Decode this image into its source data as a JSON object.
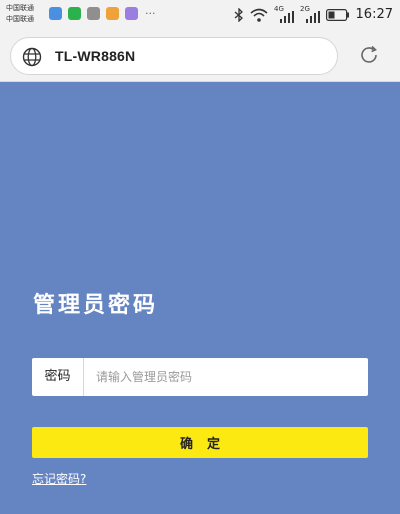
{
  "status_bar": {
    "carriers": [
      "中国联通",
      "中国联通"
    ],
    "notification_icons": [
      "app-icon",
      "wechat-icon",
      "gallery-icon",
      "app-icon",
      "app-icon"
    ],
    "more": "···",
    "network_1": "4G",
    "network_2": "2G",
    "time": "16:27"
  },
  "browser": {
    "url": "TL-WR886N"
  },
  "login": {
    "title": "管理员密码",
    "password_label": "密码",
    "password_placeholder": "请输入管理员密码",
    "password_value": "",
    "confirm_label": "确定",
    "forgot_label": "忘记密码?"
  },
  "colors": {
    "background": "#6584c2",
    "button": "#fce911",
    "text_light": "#ffffff"
  }
}
